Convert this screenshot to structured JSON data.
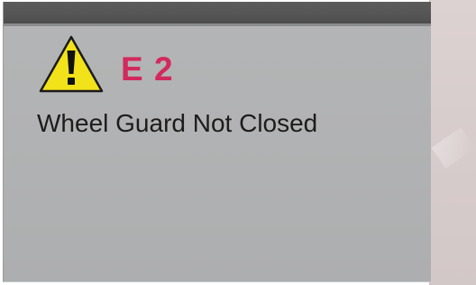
{
  "error": {
    "code": "E 2",
    "message": "Wheel Guard Not Closed",
    "icon": "warning-triangle-icon"
  },
  "colors": {
    "code_color": "#d22a5d",
    "warning_fill": "#f2e21a",
    "panel_background": "#b2b3b4",
    "title_bar": "#555555"
  }
}
